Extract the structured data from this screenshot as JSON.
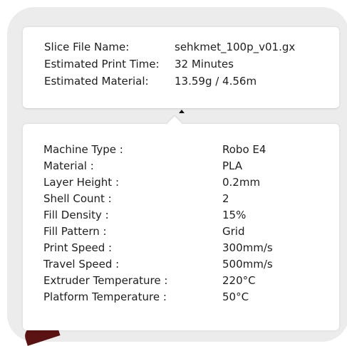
{
  "summary": {
    "rows": [
      {
        "label": "Slice File Name:",
        "value": "sehkmet_100p_v01.gx"
      },
      {
        "label": "Estimated Print Time:",
        "value": "32 Minutes"
      },
      {
        "label": "Estimated Material:",
        "value": "13.59g / 4.56m"
      }
    ]
  },
  "toggle": {
    "icon": "caret-up-icon"
  },
  "details": {
    "rows": [
      {
        "label": "Machine Type :",
        "value": "Robo E4"
      },
      {
        "label": "Material :",
        "value": "PLA"
      },
      {
        "label": "Layer Height :",
        "value": "0.2mm"
      },
      {
        "label": "Shell Count :",
        "value": "2"
      },
      {
        "label": "Fill Density :",
        "value": "15%"
      },
      {
        "label": "Fill Pattern :",
        "value": "Grid"
      },
      {
        "label": "Print Speed :",
        "value": "300mm/s"
      },
      {
        "label": "Travel Speed :",
        "value": "500mm/s"
      },
      {
        "label": "Extruder Temperature :",
        "value": "220°C"
      },
      {
        "label": "Platform Temperature :",
        "value": "50°C"
      }
    ]
  }
}
